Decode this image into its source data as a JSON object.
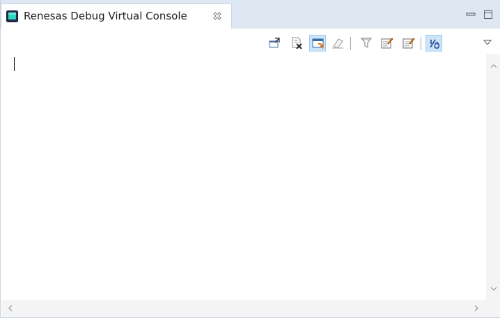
{
  "view": {
    "title": "Renesas Debug Virtual Console",
    "icon": "console-monitor-icon",
    "close_icon": "close-x-icon"
  },
  "window_controls": {
    "minimize": "minimize-icon",
    "maximize": "maximize-icon"
  },
  "toolbar": {
    "buttons": [
      {
        "icon": "open-console-icon",
        "active": false
      },
      {
        "icon": "remove-console-icon",
        "active": false
      },
      {
        "icon": "show-console-icon",
        "active": true
      },
      {
        "icon": "clear-console-icon",
        "active": false
      },
      {
        "icon": "filter-icon",
        "active": false
      },
      {
        "icon": "edit-settings-icon",
        "active": false
      },
      {
        "icon": "edit-note-icon",
        "active": false
      },
      {
        "icon": "scroll-lock-icon",
        "active": true
      }
    ],
    "view_menu": "view-menu-chevron-icon"
  },
  "console": {
    "text": ""
  },
  "colors": {
    "tab_bar": "#dfe7f2",
    "border": "#c8d4e4",
    "active_button": "#cce4f7",
    "scrollbar": "#f4f4f4"
  }
}
